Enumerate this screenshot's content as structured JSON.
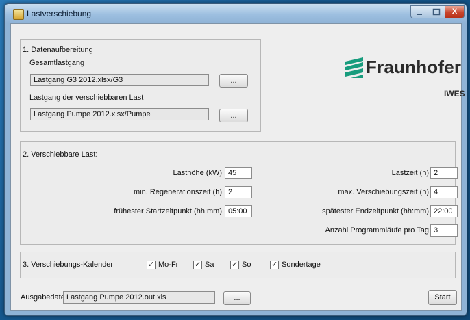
{
  "window": {
    "title": "Lastverschiebung",
    "close_symbol": "X"
  },
  "logo": {
    "name": "Fraunhofer",
    "sub": "IWES"
  },
  "section1": {
    "heading": "1. Datenaufbereitung",
    "gesamt_label": "Gesamtlastgang",
    "gesamt_value": "Lastgang G3 2012.xlsx/G3",
    "verschiebbar_label": "Lastgang der verschiebbaren Last",
    "verschiebbar_value": "Lastgang Pumpe 2012.xlsx/Pumpe",
    "browse_label": "..."
  },
  "section2": {
    "heading": "2. Verschiebbare Last:",
    "lasthoehe_label": "Lasthöhe (kW)",
    "lasthoehe_value": "45",
    "regeneration_label": "min. Regenerationszeit (h)",
    "regeneration_value": "2",
    "startzeit_label": "frühester Startzeitpunkt (hh:mm)",
    "startzeit_value": "05:00",
    "lastzeit_label": "Lastzeit (h)",
    "lastzeit_value": "2",
    "verschiebung_label": "max. Verschiebungszeit (h)",
    "verschiebung_value": "4",
    "endzeit_label": "spätester Endzeitpunkt (hh:mm)",
    "endzeit_value": "22:00",
    "programm_label": "Anzahl Programmläufe pro Tag",
    "programm_value": "3"
  },
  "section3": {
    "heading": "3. Verschiebungs-Kalender",
    "days": [
      {
        "label": "Mo-Fr",
        "checked": true
      },
      {
        "label": "Sa",
        "checked": true
      },
      {
        "label": "So",
        "checked": true
      },
      {
        "label": "Sondertage",
        "checked": true
      }
    ],
    "check_mark": "✓"
  },
  "output": {
    "label": "Ausgabedatei",
    "value": "Lastgang Pumpe 2012.out.xls",
    "browse_label": "...",
    "start_label": "Start"
  },
  "colors": {
    "logo_green": "#179c7d",
    "title_close": "#c8452c"
  }
}
